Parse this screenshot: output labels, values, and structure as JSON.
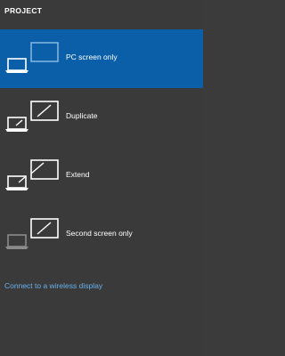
{
  "panel": {
    "title": "PROJECT"
  },
  "options": [
    {
      "label": "PC screen only",
      "icon": "pc-screen-only-icon",
      "selected": true
    },
    {
      "label": "Duplicate",
      "icon": "duplicate-icon",
      "selected": false
    },
    {
      "label": "Extend",
      "icon": "extend-icon",
      "selected": false
    },
    {
      "label": "Second screen only",
      "icon": "second-screen-only-icon",
      "selected": false
    }
  ],
  "footer": {
    "link_text": "Connect to a wireless display"
  },
  "colors": {
    "background": "#3a3a3a",
    "selected": "#0b5fa8",
    "link": "#6ab0ec"
  }
}
